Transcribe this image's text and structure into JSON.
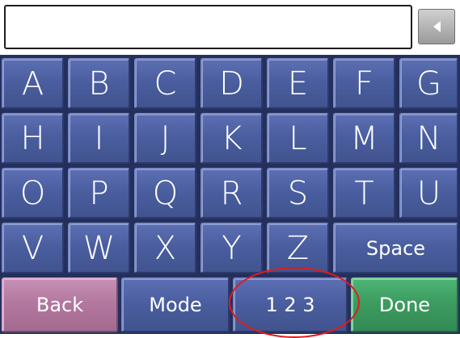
{
  "input": {
    "value": ""
  },
  "keys": {
    "row1": [
      "A",
      "B",
      "C",
      "D",
      "E",
      "F",
      "G"
    ],
    "row2": [
      "H",
      "I",
      "J",
      "K",
      "L",
      "M",
      "N"
    ],
    "row3": [
      "O",
      "P",
      "Q",
      "R",
      "S",
      "T",
      "U"
    ],
    "row4": [
      "V",
      "W",
      "X",
      "Y",
      "Z"
    ],
    "space": "Space"
  },
  "bottom": {
    "back": "Back",
    "mode": "Mode",
    "numbers": "1 2 3",
    "done": "Done"
  },
  "colors": {
    "key_blue": "#4a5ea0",
    "back_pink": "#b3789f",
    "done_green": "#3d9c60",
    "highlight_ring": "#e21a1a"
  },
  "icons": {
    "backspace": "left-triangle-icon"
  }
}
